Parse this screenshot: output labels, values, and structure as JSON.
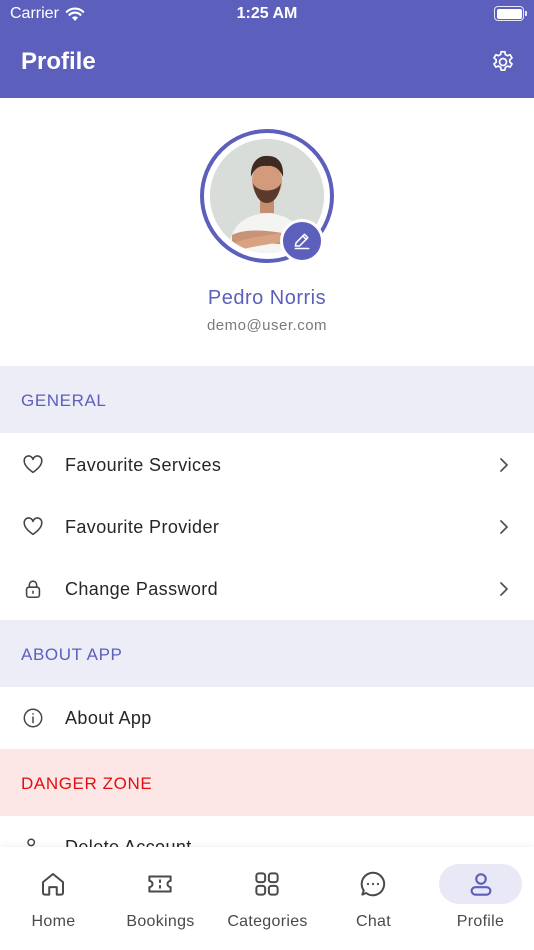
{
  "status_bar": {
    "carrier": "Carrier",
    "time": "1:25 AM"
  },
  "header": {
    "title": "Profile",
    "settings_icon": "gear-icon"
  },
  "profile": {
    "name": "Pedro Norris",
    "email": "demo@user.com"
  },
  "sections": {
    "general": "GENERAL",
    "about": "ABOUT APP",
    "danger": "DANGER ZONE"
  },
  "menu": {
    "favourite_services": "Favourite Services",
    "favourite_provider": "Favourite Provider",
    "change_password": "Change Password",
    "about_app": "About App",
    "delete_account": "Delete Account"
  },
  "tabs": {
    "home": "Home",
    "bookings": "Bookings",
    "categories": "Categories",
    "chat": "Chat",
    "profile": "Profile"
  },
  "colors": {
    "primary": "#5c5fbb",
    "section_bg": "#ededf8",
    "danger_bg": "#fde6e6",
    "danger_text": "#e01010"
  }
}
